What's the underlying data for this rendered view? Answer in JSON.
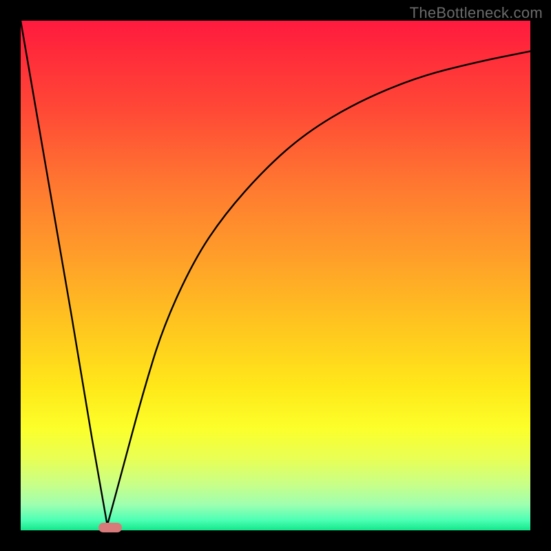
{
  "watermark": "TheBottleneck.com",
  "colors": {
    "background": "#000000",
    "curve": "#000000",
    "marker": "#d97a7a"
  },
  "chart_data": {
    "type": "line",
    "title": "",
    "xlabel": "",
    "ylabel": "",
    "xlim": [
      0,
      100
    ],
    "ylim": [
      0,
      100
    ],
    "grid": false,
    "legend": false,
    "description": "Bottleneck-style curve. A steep straight segment drops from the top-left corner down to a minimum near x≈17, then a concave-increasing curve rises toward the top-right, flattening as it goes. Background is a vertical red→yellow→green heat gradient.",
    "series": [
      {
        "name": "bottleneck-curve",
        "x": [
          0,
          5,
          10,
          14,
          17,
          20,
          24,
          28,
          34,
          40,
          48,
          56,
          66,
          78,
          90,
          100
        ],
        "values": [
          100,
          71,
          42,
          18,
          1,
          12,
          27,
          40,
          53,
          62,
          71,
          78,
          84,
          89,
          92,
          94
        ]
      }
    ],
    "marker": {
      "x": 17.5,
      "y": 0.5,
      "shape": "pill"
    }
  }
}
